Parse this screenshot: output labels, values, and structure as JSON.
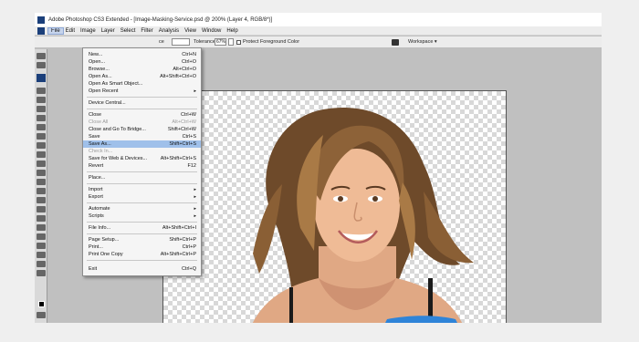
{
  "window": {
    "title": "Adobe Photoshop CS3 Extended - [Image-Masking-Service.psd @ 200% (Layer 4, RGB/8*)]"
  },
  "menubar": {
    "items": [
      "File",
      "Edit",
      "Image",
      "Layer",
      "Select",
      "Filter",
      "Analysis",
      "View",
      "Window",
      "Help"
    ],
    "active": "File"
  },
  "options": {
    "tolerance_label": "Tolerance:",
    "tolerance_value": "67%",
    "protect_fg_label": "Protect Foreground Color",
    "workspace_label": "Workspace ▾",
    "field_suffix": "ce"
  },
  "file_menu": {
    "items": [
      {
        "label": "New...",
        "shortcut": "Ctrl+N"
      },
      {
        "label": "Open...",
        "shortcut": "Ctrl+O"
      },
      {
        "label": "Browse...",
        "shortcut": "Alt+Ctrl+O"
      },
      {
        "label": "Open As...",
        "shortcut": "Alt+Shift+Ctrl+O"
      },
      {
        "label": "Open As Smart Object...",
        "shortcut": ""
      },
      {
        "label": "Open Recent",
        "shortcut": "▸"
      },
      {
        "label": "Device Central...",
        "shortcut": ""
      },
      {
        "label": "Close",
        "shortcut": "Ctrl+W"
      },
      {
        "label": "Close All",
        "shortcut": "Alt+Ctrl+W"
      },
      {
        "label": "Close and Go To Bridge...",
        "shortcut": "Shift+Ctrl+W"
      },
      {
        "label": "Save",
        "shortcut": "Ctrl+S"
      },
      {
        "label": "Save As...",
        "shortcut": "Shift+Ctrl+S"
      },
      {
        "label": "Check In...",
        "shortcut": ""
      },
      {
        "label": "Save for Web & Devices...",
        "shortcut": "Alt+Shift+Ctrl+S"
      },
      {
        "label": "Revert",
        "shortcut": "F12"
      },
      {
        "label": "Place...",
        "shortcut": ""
      },
      {
        "label": "Import",
        "shortcut": "▸"
      },
      {
        "label": "Export",
        "shortcut": "▸"
      },
      {
        "label": "Automate",
        "shortcut": "▸"
      },
      {
        "label": "Scripts",
        "shortcut": "▸"
      },
      {
        "label": "File Info...",
        "shortcut": "Alt+Shift+Ctrl+I"
      },
      {
        "label": "Page Setup...",
        "shortcut": "Shift+Ctrl+P"
      },
      {
        "label": "Print...",
        "shortcut": "Ctrl+P"
      },
      {
        "label": "Print One Copy",
        "shortcut": "Alt+Shift+Ctrl+P"
      },
      {
        "label": "Exit",
        "shortcut": "Ctrl+Q"
      }
    ],
    "highlighted": "Save As...",
    "disabled": [
      "Close All",
      "Check In..."
    ]
  },
  "colors": {
    "menu_highlight": "#9fc0ea",
    "ps_blue": "#1b3f7a",
    "top_blue": "#2f84d8"
  }
}
